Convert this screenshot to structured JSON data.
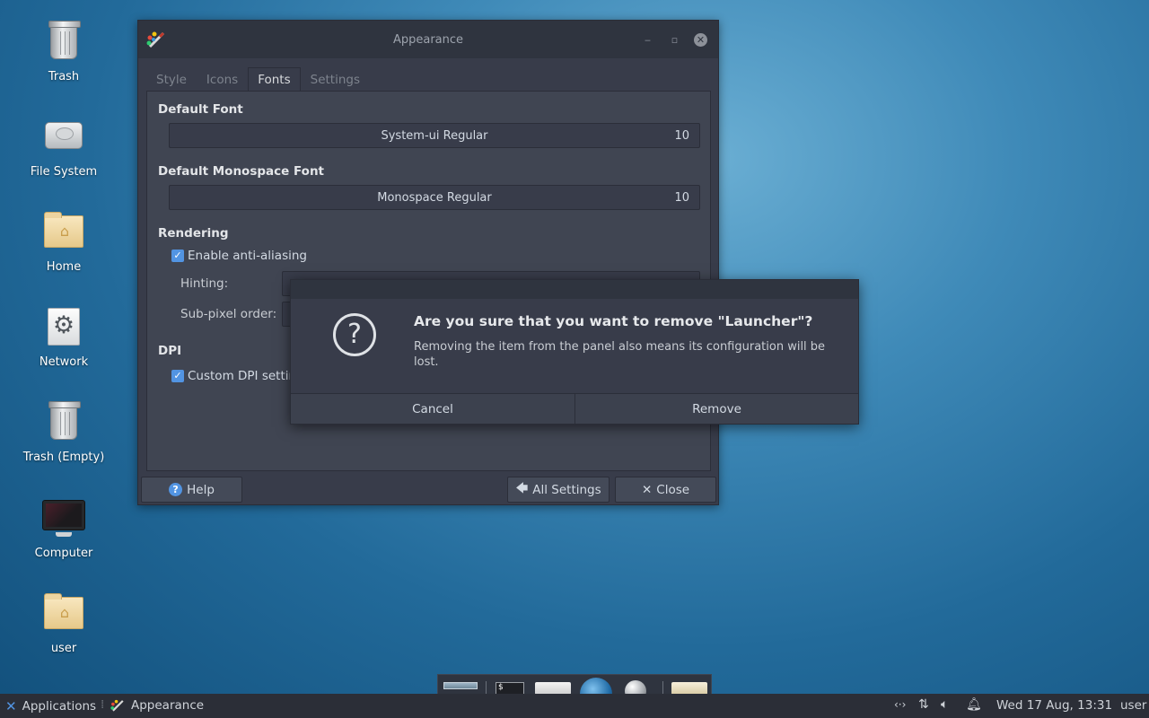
{
  "desktop": {
    "icons": [
      {
        "label": "Trash"
      },
      {
        "label": "File System"
      },
      {
        "label": "Home"
      },
      {
        "label": "Network"
      },
      {
        "label": "Trash (Empty)"
      },
      {
        "label": "Computer"
      },
      {
        "label": "user"
      }
    ]
  },
  "window": {
    "title": "Appearance",
    "tabs": [
      {
        "label": "Style"
      },
      {
        "label": "Icons"
      },
      {
        "label": "Fonts"
      },
      {
        "label": "Settings"
      }
    ],
    "active_tab": "Fonts",
    "default_font": {
      "heading": "Default Font",
      "name": "System-ui Regular",
      "size": "10"
    },
    "monospace_font": {
      "heading": "Default Monospace Font",
      "name": "Monospace Regular",
      "size": "10"
    },
    "rendering": {
      "heading": "Rendering",
      "antialias_label": "Enable anti-aliasing",
      "antialias_checked": true,
      "hinting_label": "Hinting:",
      "subpixel_label": "Sub-pixel order:"
    },
    "dpi": {
      "heading": "DPI",
      "custom_label": "Custom DPI settin",
      "custom_checked": true
    },
    "buttons": {
      "help": "Help",
      "all_settings": "All Settings",
      "close": "Close"
    }
  },
  "dialog": {
    "heading": "Are you sure that you want to remove \"Launcher\"?",
    "body": "Removing the item from the panel also means its configuration will be lost.",
    "cancel": "Cancel",
    "remove": "Remove"
  },
  "taskbar": {
    "applications": "Applications",
    "window_button": "Appearance",
    "clock": "Wed 17 Aug, 13:31",
    "user": "user"
  },
  "colors": {
    "accent": "#5294e2",
    "window_bg": "#383c4a",
    "titlebar_bg": "#2f343f"
  }
}
